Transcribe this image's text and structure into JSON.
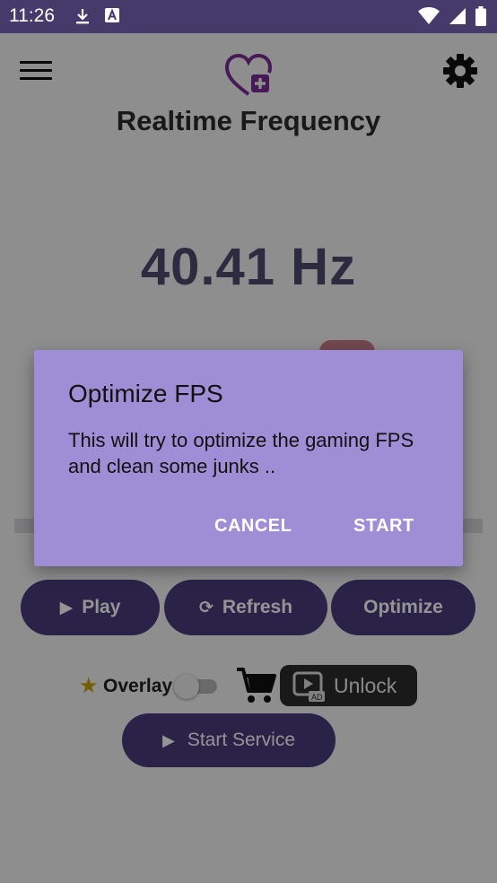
{
  "status_bar": {
    "time": "11:26",
    "icons_left": [
      "download-icon",
      "font-a-icon"
    ],
    "icons_right": [
      "wifi-icon",
      "signal-icon",
      "battery-icon"
    ]
  },
  "header": {
    "title": "Realtime Frequency",
    "logo_icon": "heart-plus-icon",
    "menu_icon": "hamburger-menu-icon",
    "settings_icon": "gear-icon"
  },
  "frequency": {
    "value": "40.41 Hz"
  },
  "actions": {
    "play_label": "Play",
    "refresh_label": "Refresh",
    "optimize_label": "Optimize"
  },
  "overlay": {
    "label": "Overlay",
    "enabled": false,
    "unlock_label": "Unlock",
    "ad_badge": "AD"
  },
  "service": {
    "start_label": "Start Service"
  },
  "dialog": {
    "title": "Optimize FPS",
    "message": "This will try to optimize the gaming FPS and clean some junks ..",
    "cancel_label": "CANCEL",
    "start_label": "START"
  },
  "colors": {
    "accent": "#4a3c7d",
    "dialog_bg": "#9f8dd6",
    "status_bar": "#453a6a",
    "logo": "#7b2c94"
  }
}
